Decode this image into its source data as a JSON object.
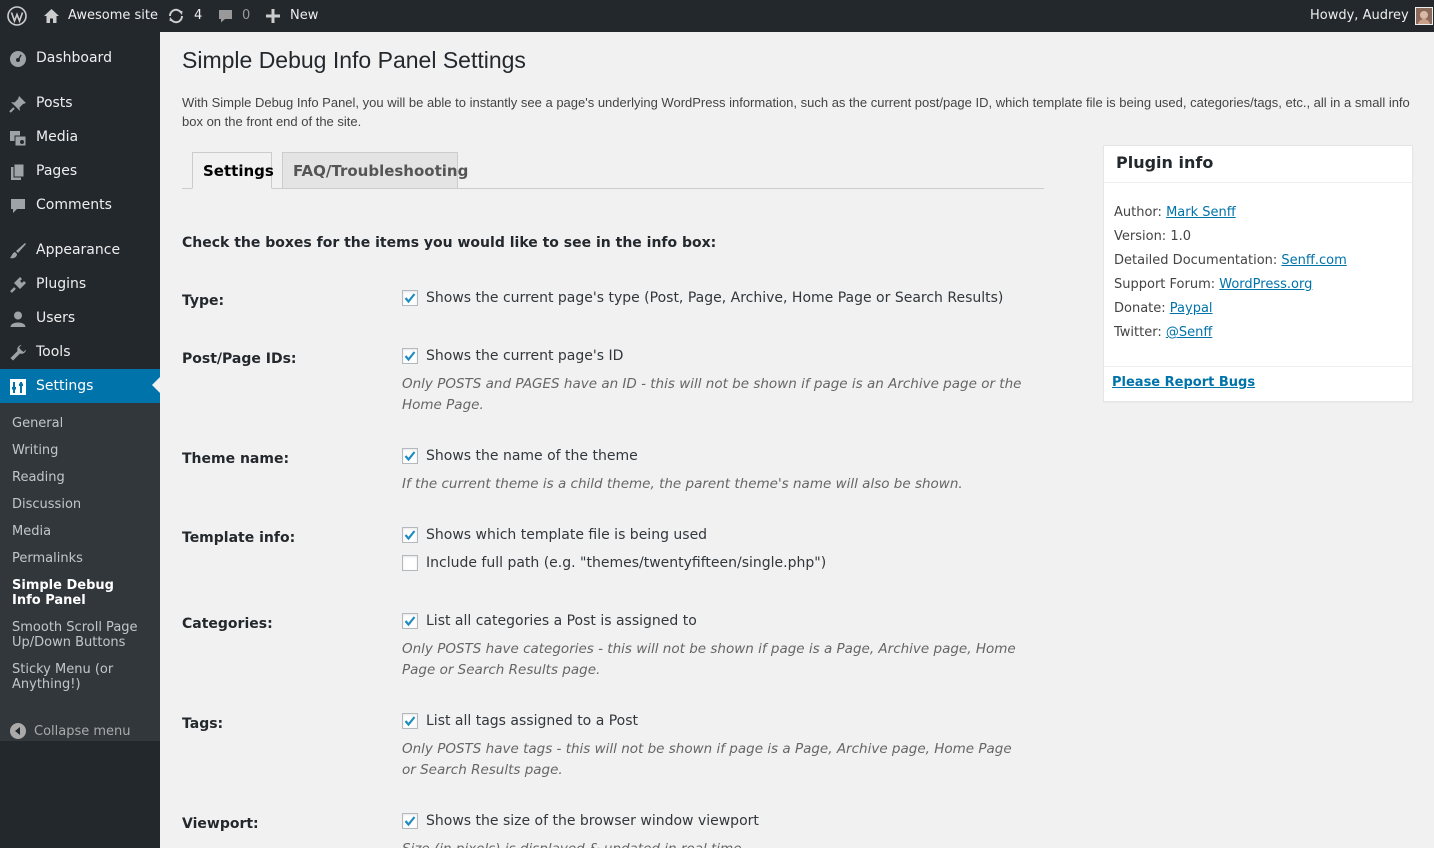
{
  "adminbar": {
    "site_name": "Awesome site",
    "updates_count": "4",
    "comments_count": "0",
    "new_label": "New",
    "howdy": "Howdy, Audrey"
  },
  "sidebar": {
    "items": [
      {
        "label": "Dashboard",
        "icon": "dashboard-icon"
      },
      {
        "label": "Posts",
        "icon": "pin-icon"
      },
      {
        "label": "Media",
        "icon": "media-icon"
      },
      {
        "label": "Pages",
        "icon": "pages-icon"
      },
      {
        "label": "Comments",
        "icon": "comment-icon"
      },
      {
        "label": "Appearance",
        "icon": "brush-icon"
      },
      {
        "label": "Plugins",
        "icon": "plug-icon"
      },
      {
        "label": "Users",
        "icon": "user-icon"
      },
      {
        "label": "Tools",
        "icon": "wrench-icon"
      },
      {
        "label": "Settings",
        "icon": "settings-icon"
      }
    ],
    "submenu": [
      "General",
      "Writing",
      "Reading",
      "Discussion",
      "Media",
      "Permalinks",
      "Simple Debug Info Panel",
      "Smooth Scroll Page Up/Down Buttons",
      "Sticky Menu (or Anything!)"
    ],
    "collapse_label": "Collapse menu"
  },
  "main": {
    "title": "Simple Debug Info Panel Settings",
    "intro": "With Simple Debug Info Panel, you will be able to instantly see a page's underlying WordPress information, such as the current post/page ID, which template file is being used, categories/tags, etc., all in a small info box on the front end of the site.",
    "tabs": [
      {
        "label": "Settings",
        "active": true
      },
      {
        "label": "FAQ/Troubleshooting",
        "active": false
      }
    ],
    "instruction": "Check the boxes for the items you would like to see in the info box:",
    "rows": [
      {
        "label": "Type:",
        "options": [
          {
            "text": "Shows the current page's type (Post, Page, Archive, Home Page or Search Results)",
            "checked": true
          }
        ],
        "desc": ""
      },
      {
        "label": "Post/Page IDs:",
        "options": [
          {
            "text": "Shows the current page's ID",
            "checked": true
          }
        ],
        "desc": "Only POSTS and PAGES have an ID - this will not be shown if page is an Archive page or the Home Page."
      },
      {
        "label": "Theme name:",
        "options": [
          {
            "text": "Shows the name of the theme",
            "checked": true
          }
        ],
        "desc": "If the current theme is a child theme, the parent theme's name will also be shown."
      },
      {
        "label": "Template info:",
        "options": [
          {
            "text": "Shows which template file is being used",
            "checked": true
          },
          {
            "text": "Include full path (e.g. \"themes/twentyfifteen/single.php\")",
            "checked": false
          }
        ],
        "desc": ""
      },
      {
        "label": "Categories:",
        "options": [
          {
            "text": "List all categories a Post is assigned to",
            "checked": true
          }
        ],
        "desc": "Only POSTS have categories - this will not be shown if page is a Page, Archive page, Home Page or Search Results page."
      },
      {
        "label": "Tags:",
        "options": [
          {
            "text": "List all tags assigned to a Post",
            "checked": true
          }
        ],
        "desc": "Only POSTS have tags - this will not be shown if page is a Page, Archive page, Home Page or Search Results page."
      },
      {
        "label": "Viewport:",
        "options": [
          {
            "text": "Shows the size of the browser window viewport",
            "checked": true
          }
        ],
        "desc": "Size (in pixels) is displayed & updated in real time."
      }
    ]
  },
  "plugin_info": {
    "title": "Plugin info",
    "author_label": "Author:",
    "author_link": "Mark Senff",
    "version_label": "Version:",
    "version_value": "1.0",
    "docs_label": "Detailed Documentation:",
    "docs_link": "Senff.com",
    "forum_label": "Support Forum:",
    "forum_link": "WordPress.org",
    "donate_label": "Donate:",
    "donate_link": "Paypal",
    "twitter_label": "Twitter:",
    "twitter_link": "@Senff",
    "report_bugs": "Please Report Bugs"
  },
  "colors": {
    "adminbar_bg": "#23282d",
    "menu_bg": "#23282d",
    "submenu_bg": "#32373c",
    "accent": "#0073aa",
    "page_bg": "#f1f1f1",
    "check": "#1e8cbe"
  }
}
